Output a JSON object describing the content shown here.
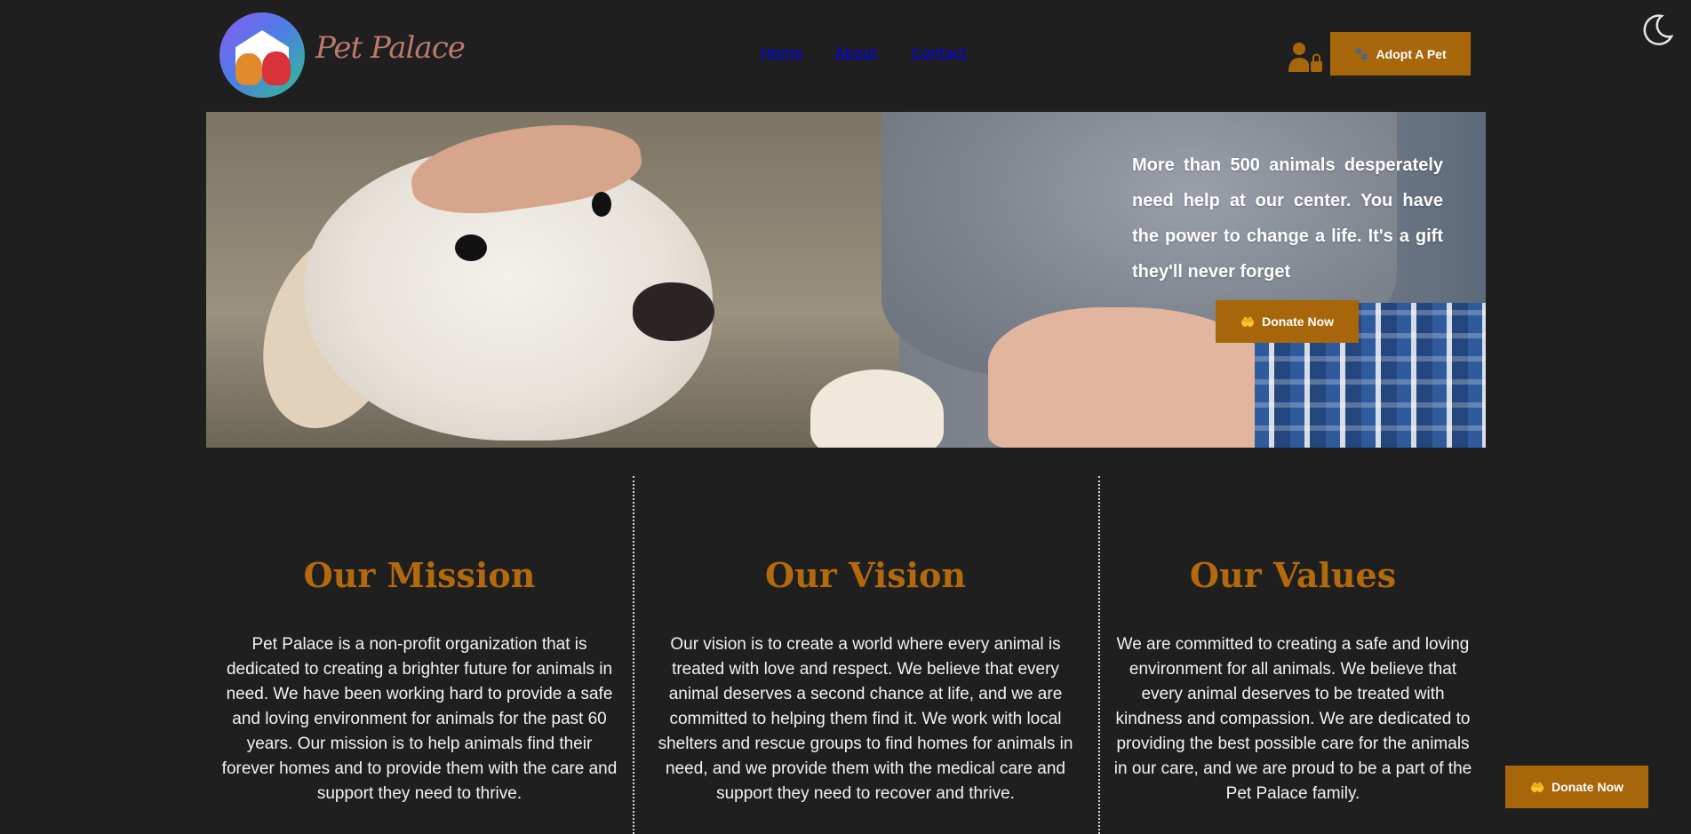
{
  "header": {
    "brand": "Pet Palace",
    "nav": [
      {
        "label": "Home",
        "active": true
      },
      {
        "label": "About",
        "active": false
      },
      {
        "label": "Contact",
        "active": false
      }
    ],
    "adopt_button": "Adopt A Pet",
    "adopt_icon": "paw-icon",
    "user_icon": "user-lock-icon",
    "theme_icon": "moon-icon"
  },
  "hero": {
    "text": "More than 500 animals desperately need help at our center. You have the power to change a life. It's a gift they'll never forget",
    "donate_button": "Donate Now",
    "donate_icon": "hand-holding-heart-icon"
  },
  "columns": [
    {
      "title": "Our Mission",
      "body": "Pet Palace is a non-profit organization that is dedicated to creating a brighter future for animals in need. We have been working hard to provide a safe and loving environment for animals for the past 60 years. Our mission is to help animals find their forever homes and to provide them with the care and support they need to thrive."
    },
    {
      "title": "Our Vision",
      "body": "Our vision is to create a world where every animal is treated with love and respect. We believe that every animal deserves a second chance at life, and we are committed to helping them find it. We work with local shelters and rescue groups to find homes for animals in need, and we provide them with the medical care and support they need to recover and thrive."
    },
    {
      "title": "Our Values",
      "body": "We are committed to creating a safe and loving environment for all animals. We believe that every animal deserves to be treated with kindness and compassion. We are dedicated to providing the best possible care for the animals in our care, and we are proud to be a part of the Pet Palace family."
    }
  ],
  "floating_donate": "Donate Now",
  "colors": {
    "background": "#1f1f1f",
    "accent": "#a8660b",
    "heading": "#b26a0d",
    "text": "#f2f2f2"
  }
}
